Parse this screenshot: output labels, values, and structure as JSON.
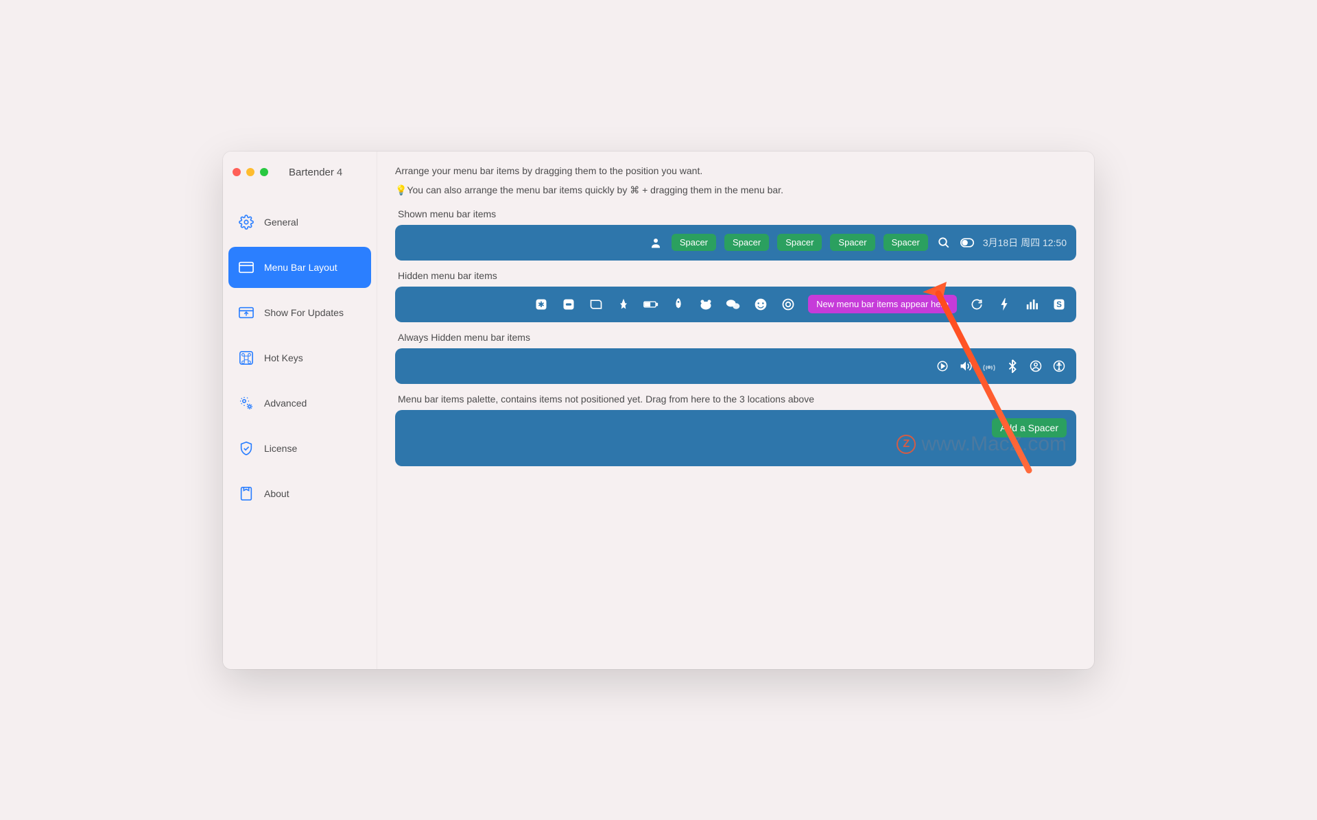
{
  "app": {
    "title": "Bartender",
    "version": "4"
  },
  "sidebar": {
    "items": [
      {
        "id": "general",
        "label": "General"
      },
      {
        "id": "menu-bar-layout",
        "label": "Menu Bar Layout"
      },
      {
        "id": "show-for-updates",
        "label": "Show For Updates"
      },
      {
        "id": "hot-keys",
        "label": "Hot Keys"
      },
      {
        "id": "advanced",
        "label": "Advanced"
      },
      {
        "id": "license",
        "label": "License"
      },
      {
        "id": "about",
        "label": "About"
      }
    ],
    "active": "menu-bar-layout"
  },
  "main": {
    "description": "Arrange your menu bar items by dragging them to the position you want.",
    "tip_prefix": "💡You can also arrange the menu bar items quickly by ",
    "tip_key": "⌘",
    "tip_suffix": " + dragging them in the menu bar.",
    "shown_label": "Shown menu bar items",
    "hidden_label": "Hidden menu bar items",
    "always_hidden_label": "Always Hidden menu bar items",
    "palette_label": "Menu bar items palette, contains items not positioned yet. Drag from here to the 3 locations above",
    "spacer_label": "Spacer",
    "new_items_label": "New menu bar items appear here",
    "add_spacer_label": "Add a Spacer",
    "datetime": "3月18日 周四  12:50"
  },
  "watermark": "www.MacZ.com"
}
